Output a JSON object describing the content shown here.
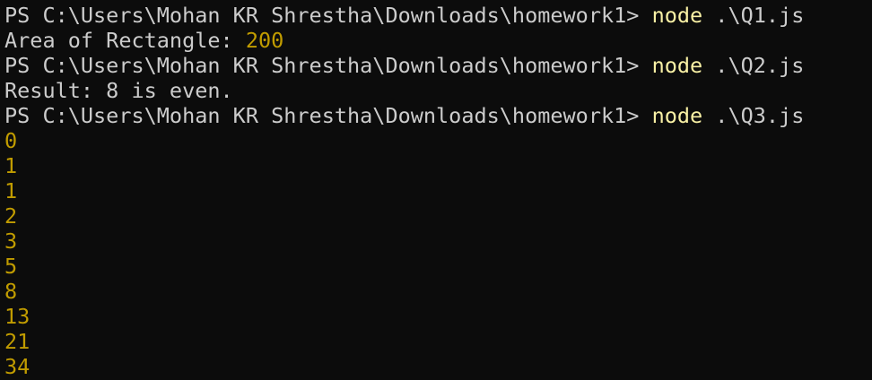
{
  "terminal": {
    "colors": {
      "background": "#0c0c0c",
      "text": "#cccccc",
      "command": "#f9f1a5",
      "number": "#c19c00"
    },
    "prompt": "PS C:\\Users\\Mohan KR Shrestha\\Downloads\\homework1> ",
    "lines": [
      {
        "command": "node",
        "args": " .\\Q1.js"
      },
      {
        "label": "Area of Rectangle: ",
        "value": "200"
      },
      {
        "command": "node",
        "args": " .\\Q2.js"
      },
      {
        "text": "Result: 8 is even."
      },
      {
        "command": "node",
        "args": " .\\Q3.js"
      }
    ],
    "fibonacci": [
      "0",
      "1",
      "1",
      "2",
      "3",
      "5",
      "8",
      "13",
      "21",
      "34"
    ]
  }
}
